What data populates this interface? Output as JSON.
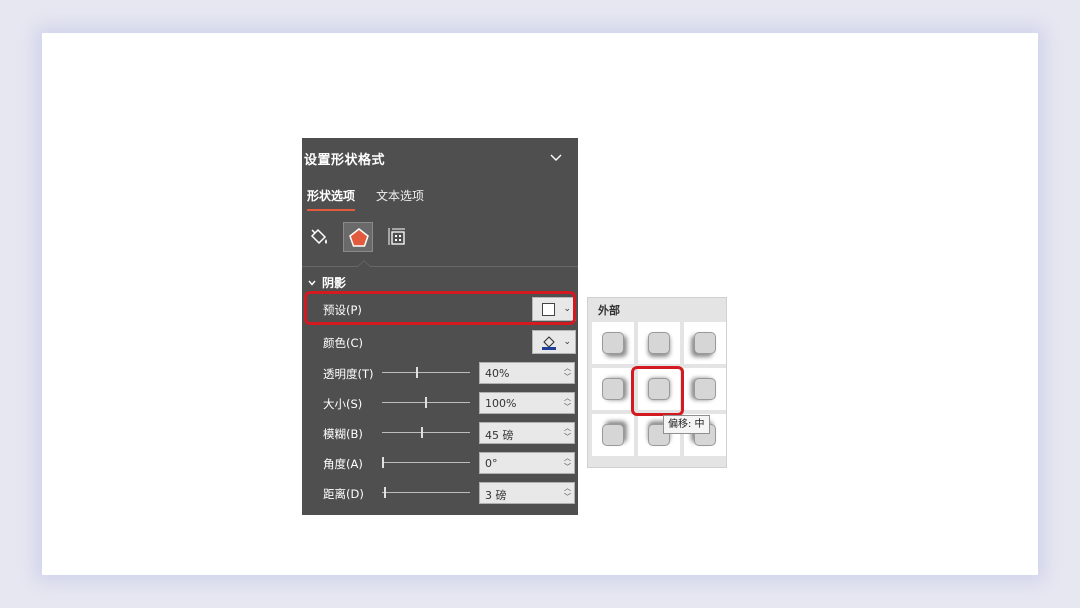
{
  "panel": {
    "title": "设置形状格式",
    "tabs": [
      {
        "label": "形状选项",
        "active": true
      },
      {
        "label": "文本选项",
        "active": false
      }
    ],
    "icons": [
      "fill-line-icon",
      "effects-icon",
      "size-properties-icon"
    ],
    "section": {
      "label": "阴影",
      "expanded": true
    },
    "rows": {
      "preset": {
        "label": "预设(P)"
      },
      "color": {
        "label": "颜色(C)",
        "swatch": "#1f3f99"
      },
      "transparency": {
        "label": "透明度(T)",
        "value": "40%",
        "slider_fraction": 0.4
      },
      "size": {
        "label": "大小(S)",
        "value": "100%",
        "slider_fraction": 0.5
      },
      "blur": {
        "label": "模糊(B)",
        "value": "45 磅",
        "slider_fraction": 0.45
      },
      "angle": {
        "label": "角度(A)",
        "value": "0°",
        "slider_fraction": 0.0
      },
      "distance": {
        "label": "距离(D)",
        "value": "3 磅",
        "slider_fraction": 0.02
      }
    }
  },
  "flyout": {
    "heading": "外部",
    "presets": [
      "offset-top-left",
      "offset-top",
      "offset-top-right",
      "offset-left",
      "offset-center",
      "offset-right",
      "offset-bottom-left",
      "offset-bottom",
      "offset-bottom-right"
    ],
    "selected": "offset-center",
    "tooltip": "偏移: 中"
  },
  "colors": {
    "accent": "#e25b3c",
    "highlight": "#d41a21",
    "panel_bg": "#4f4f4f"
  }
}
